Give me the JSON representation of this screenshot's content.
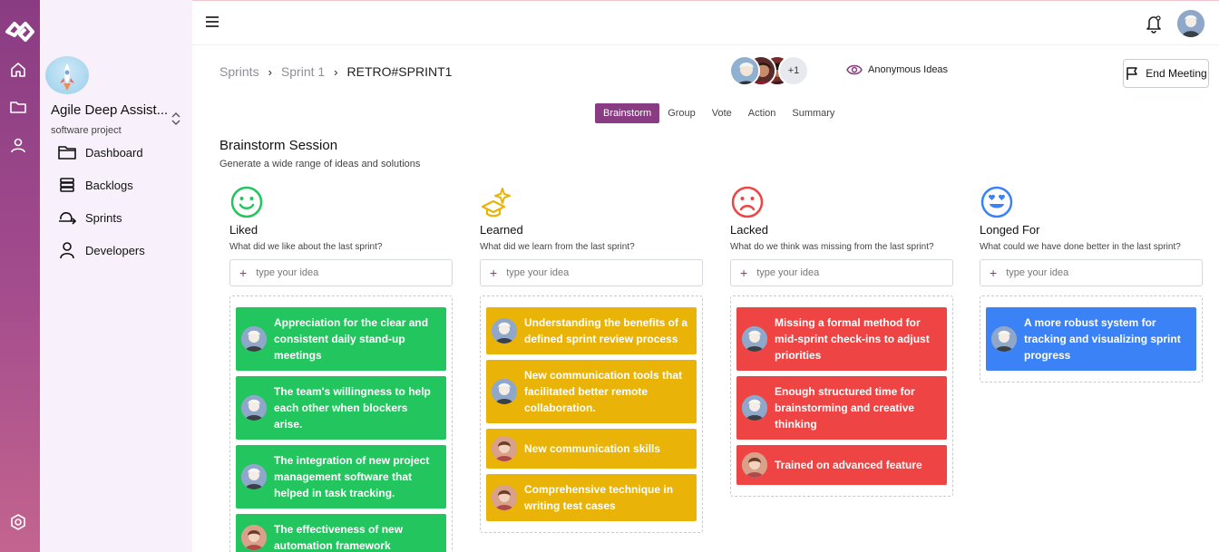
{
  "topbar": {
    "menu_icon": "hamburger-icon",
    "bell_icon": "bell-icon"
  },
  "project": {
    "name": "Agile Deep Assist...",
    "type": "software project"
  },
  "nav": [
    {
      "label": "Dashboard",
      "icon": "folder-icon"
    },
    {
      "label": "Backlogs",
      "icon": "stack-icon"
    },
    {
      "label": "Sprints",
      "icon": "sprint-icon"
    },
    {
      "label": "Developers",
      "icon": "user-icon"
    }
  ],
  "breadcrumb": {
    "item1": "Sprints",
    "item2": "Sprint 1",
    "current": "RETRO#SPRINT1"
  },
  "participants": {
    "more": "+1"
  },
  "anonymous_label": "Anonymous Ideas",
  "end_meeting_label": "End Meeting",
  "tabs": [
    "Brainstorm",
    "Group",
    "Vote",
    "Action",
    "Summary"
  ],
  "session": {
    "title": "Brainstorm Session",
    "subtitle": "Generate a wide range of ideas and solutions"
  },
  "input_placeholder": "type your idea",
  "colors": {
    "accent": "#8a3c82",
    "liked": "#22c55e",
    "learned": "#eab308",
    "lacked": "#ef4444",
    "longed": "#3b82f6"
  },
  "columns": [
    {
      "title": "Liked",
      "question": "What did we like about the last sprint?",
      "cards": [
        "Appreciation for the clear and consistent daily stand-up meetings",
        "The team's willingness to help each other when blockers arise.",
        "The integration of new project management software that helped in task tracking.",
        "The effectiveness of new automation framework"
      ]
    },
    {
      "title": "Learned",
      "question": "What did we learn from the last sprint?",
      "cards": [
        "Understanding the benefits of a defined sprint review process",
        "New communication tools that facilitated better remote collaboration.",
        "New communication skills",
        "Comprehensive technique in writing test cases"
      ]
    },
    {
      "title": "Lacked",
      "question": "What do we think was missing from the last sprint?",
      "cards": [
        "Missing a formal method for mid-sprint check-ins to adjust priorities",
        "Enough structured time for brainstorming and creative thinking",
        "Trained on advanced feature"
      ]
    },
    {
      "title": "Longed For",
      "question": "What could we have done better in the last sprint?",
      "cards": [
        "A more robust system for tracking and visualizing sprint progress"
      ]
    }
  ]
}
